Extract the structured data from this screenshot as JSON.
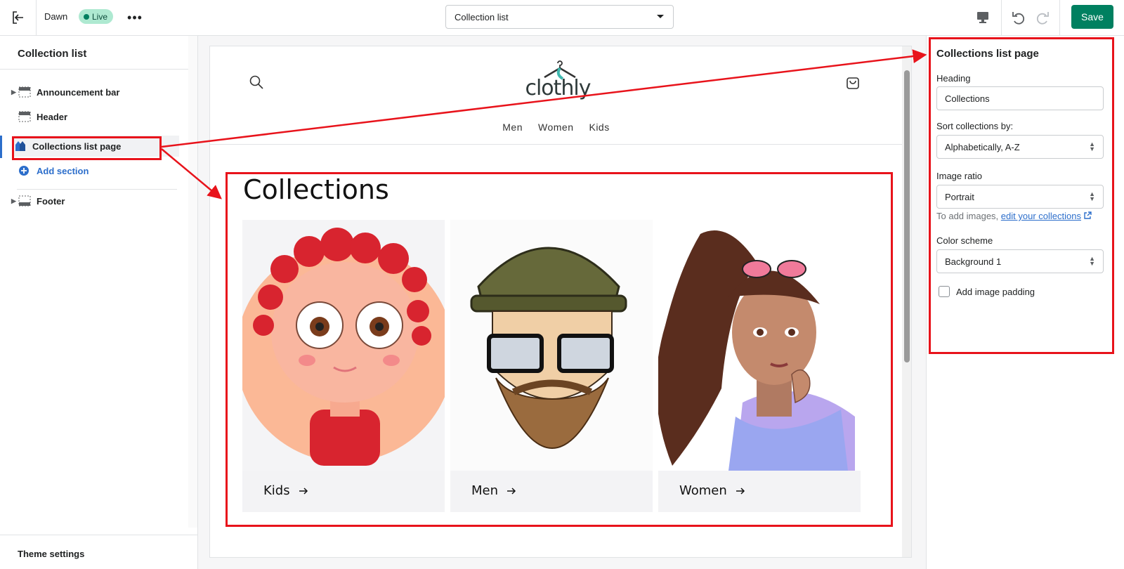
{
  "topbar": {
    "theme_name": "Dawn",
    "status": "Live",
    "page_selector": "Collection list",
    "save_label": "Save"
  },
  "sidebar": {
    "title": "Collection list",
    "items": [
      {
        "label": "Announcement bar"
      },
      {
        "label": "Header"
      },
      {
        "label": "Collections list page"
      },
      {
        "label": "Add section"
      },
      {
        "label": "Footer"
      }
    ],
    "theme_settings": "Theme settings"
  },
  "preview": {
    "logo_text": "clothly",
    "nav": [
      "Men",
      "Women",
      "Kids"
    ],
    "heading": "Collections",
    "cards": [
      {
        "label": "Kids"
      },
      {
        "label": "Men"
      },
      {
        "label": "Women"
      }
    ]
  },
  "settings": {
    "title": "Collections list page",
    "heading_label": "Heading",
    "heading_value": "Collections",
    "sort_label": "Sort collections by:",
    "sort_value": "Alphabetically, A-Z",
    "ratio_label": "Image ratio",
    "ratio_value": "Portrait",
    "hint_prefix": "To add images,",
    "hint_link": "edit your collections",
    "color_label": "Color scheme",
    "color_value": "Background 1",
    "padding_label": "Add image padding"
  },
  "colors": {
    "accent": "#008060",
    "link": "#2c6ecb",
    "annotation": "#e8131b"
  }
}
